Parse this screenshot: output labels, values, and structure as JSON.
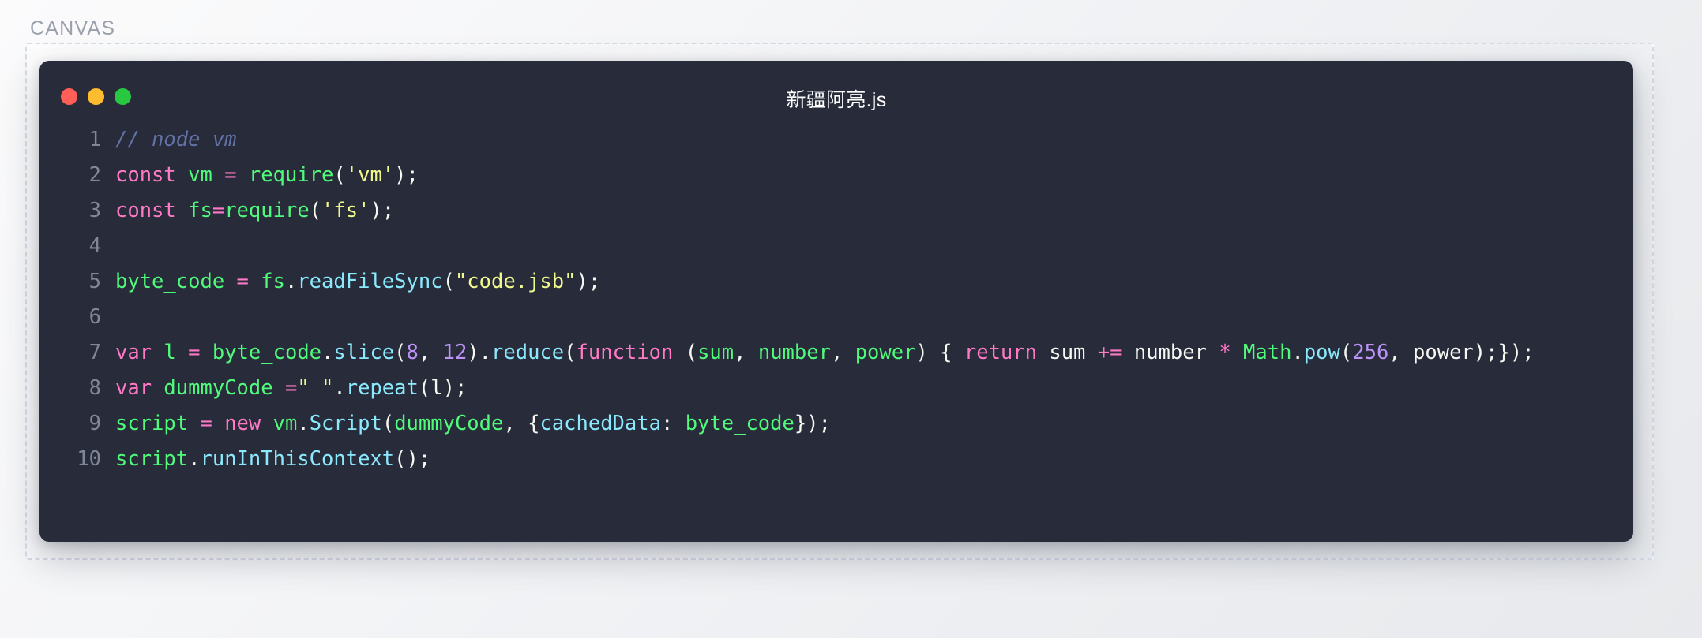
{
  "canvas": {
    "label": "CANVAS"
  },
  "window": {
    "title": "新疆阿亮.js",
    "traffic_lights": [
      {
        "name": "close",
        "color": "#ff5f57"
      },
      {
        "name": "minimize",
        "color": "#febc2e"
      },
      {
        "name": "maximize",
        "color": "#28c840"
      }
    ],
    "background_color": "#282c3a"
  },
  "editor": {
    "language": "javascript",
    "theme": "dracula",
    "line_numbers": [
      "1",
      "2",
      "3",
      "4",
      "5",
      "6",
      "7",
      "8",
      "9",
      "10"
    ],
    "lines": [
      {
        "number": "1",
        "text": "// node vm",
        "tokens": [
          {
            "t": "// node vm",
            "c": "t-comment"
          }
        ]
      },
      {
        "number": "2",
        "text": "const vm = require('vm');",
        "tokens": [
          {
            "t": "const",
            "c": "t-keyword"
          },
          {
            "t": " ",
            "c": "t-plain"
          },
          {
            "t": "vm",
            "c": "t-var"
          },
          {
            "t": " ",
            "c": "t-plain"
          },
          {
            "t": "=",
            "c": "t-op"
          },
          {
            "t": " ",
            "c": "t-plain"
          },
          {
            "t": "require",
            "c": "t-func"
          },
          {
            "t": "(",
            "c": "t-punct"
          },
          {
            "t": "'vm'",
            "c": "t-string"
          },
          {
            "t": ")",
            "c": "t-punct"
          },
          {
            "t": ";",
            "c": "t-punct"
          }
        ]
      },
      {
        "number": "3",
        "text": "const fs=require('fs');",
        "tokens": [
          {
            "t": "const",
            "c": "t-keyword"
          },
          {
            "t": " ",
            "c": "t-plain"
          },
          {
            "t": "fs",
            "c": "t-var"
          },
          {
            "t": "=",
            "c": "t-op"
          },
          {
            "t": "require",
            "c": "t-func"
          },
          {
            "t": "(",
            "c": "t-punct"
          },
          {
            "t": "'fs'",
            "c": "t-string"
          },
          {
            "t": ")",
            "c": "t-punct"
          },
          {
            "t": ";",
            "c": "t-punct"
          }
        ]
      },
      {
        "number": "4",
        "text": "",
        "tokens": []
      },
      {
        "number": "5",
        "text": "byte_code = fs.readFileSync(\"code.jsb\");",
        "tokens": [
          {
            "t": "byte_code",
            "c": "t-var"
          },
          {
            "t": " ",
            "c": "t-plain"
          },
          {
            "t": "=",
            "c": "t-op"
          },
          {
            "t": " ",
            "c": "t-plain"
          },
          {
            "t": "fs",
            "c": "t-var"
          },
          {
            "t": ".",
            "c": "t-punct"
          },
          {
            "t": "readFileSync",
            "c": "t-method"
          },
          {
            "t": "(",
            "c": "t-punct"
          },
          {
            "t": "\"code.jsb\"",
            "c": "t-string"
          },
          {
            "t": ")",
            "c": "t-punct"
          },
          {
            "t": ";",
            "c": "t-punct"
          }
        ]
      },
      {
        "number": "6",
        "text": "",
        "tokens": []
      },
      {
        "number": "7",
        "text": "var l = byte_code.slice(8, 12).reduce(function (sum, number, power) { return sum += number * Math.pow(256, power);});",
        "tokens": [
          {
            "t": "var",
            "c": "t-keyword"
          },
          {
            "t": " ",
            "c": "t-plain"
          },
          {
            "t": "l",
            "c": "t-var"
          },
          {
            "t": " ",
            "c": "t-plain"
          },
          {
            "t": "=",
            "c": "t-op"
          },
          {
            "t": " ",
            "c": "t-plain"
          },
          {
            "t": "byte_code",
            "c": "t-var"
          },
          {
            "t": ".",
            "c": "t-punct"
          },
          {
            "t": "slice",
            "c": "t-method"
          },
          {
            "t": "(",
            "c": "t-punct"
          },
          {
            "t": "8",
            "c": "t-number"
          },
          {
            "t": ", ",
            "c": "t-punct"
          },
          {
            "t": "12",
            "c": "t-number"
          },
          {
            "t": ")",
            "c": "t-punct"
          },
          {
            "t": ".",
            "c": "t-punct"
          },
          {
            "t": "reduce",
            "c": "t-method"
          },
          {
            "t": "(",
            "c": "t-punct"
          },
          {
            "t": "function",
            "c": "t-keyword"
          },
          {
            "t": " (",
            "c": "t-punct"
          },
          {
            "t": "sum",
            "c": "t-var"
          },
          {
            "t": ", ",
            "c": "t-punct"
          },
          {
            "t": "number",
            "c": "t-var"
          },
          {
            "t": ", ",
            "c": "t-punct"
          },
          {
            "t": "power",
            "c": "t-var"
          },
          {
            "t": ")",
            "c": "t-punct"
          },
          {
            "t": " { ",
            "c": "t-punct"
          },
          {
            "t": "return",
            "c": "t-keyword"
          },
          {
            "t": " sum ",
            "c": "t-plain"
          },
          {
            "t": "+=",
            "c": "t-op"
          },
          {
            "t": " number ",
            "c": "t-plain"
          },
          {
            "t": "*",
            "c": "t-op"
          },
          {
            "t": " ",
            "c": "t-plain"
          },
          {
            "t": "Math",
            "c": "t-var"
          },
          {
            "t": ".",
            "c": "t-punct"
          },
          {
            "t": "pow",
            "c": "t-method"
          },
          {
            "t": "(",
            "c": "t-punct"
          },
          {
            "t": "256",
            "c": "t-number"
          },
          {
            "t": ", ",
            "c": "t-punct"
          },
          {
            "t": "power",
            "c": "t-plain"
          },
          {
            "t": ");});",
            "c": "t-punct"
          }
        ]
      },
      {
        "number": "8",
        "text": "var dummyCode =\" \".repeat(l);",
        "tokens": [
          {
            "t": "var",
            "c": "t-keyword"
          },
          {
            "t": " ",
            "c": "t-plain"
          },
          {
            "t": "dummyCode",
            "c": "t-var"
          },
          {
            "t": " ",
            "c": "t-plain"
          },
          {
            "t": "=",
            "c": "t-op"
          },
          {
            "t": "\" \"",
            "c": "t-string"
          },
          {
            "t": ".",
            "c": "t-punct"
          },
          {
            "t": "repeat",
            "c": "t-method"
          },
          {
            "t": "(",
            "c": "t-punct"
          },
          {
            "t": "l",
            "c": "t-plain"
          },
          {
            "t": ")",
            "c": "t-punct"
          },
          {
            "t": ";",
            "c": "t-punct"
          }
        ]
      },
      {
        "number": "9",
        "text": "script = new vm.Script(dummyCode, {cachedData: byte_code});",
        "tokens": [
          {
            "t": "script",
            "c": "t-var"
          },
          {
            "t": " ",
            "c": "t-plain"
          },
          {
            "t": "=",
            "c": "t-op"
          },
          {
            "t": " ",
            "c": "t-plain"
          },
          {
            "t": "new",
            "c": "t-keyword"
          },
          {
            "t": " ",
            "c": "t-plain"
          },
          {
            "t": "vm",
            "c": "t-var"
          },
          {
            "t": ".",
            "c": "t-punct"
          },
          {
            "t": "Script",
            "c": "t-method"
          },
          {
            "t": "(",
            "c": "t-punct"
          },
          {
            "t": "dummyCode",
            "c": "t-var"
          },
          {
            "t": ", ",
            "c": "t-punct"
          },
          {
            "t": "{",
            "c": "t-punct"
          },
          {
            "t": "cachedData",
            "c": "t-prop"
          },
          {
            "t": ": ",
            "c": "t-punct"
          },
          {
            "t": "byte_code",
            "c": "t-var"
          },
          {
            "t": "});",
            "c": "t-punct"
          }
        ]
      },
      {
        "number": "10",
        "text": "script.runInThisContext();",
        "tokens": [
          {
            "t": "script",
            "c": "t-var"
          },
          {
            "t": ".",
            "c": "t-punct"
          },
          {
            "t": "runInThisContext",
            "c": "t-method"
          },
          {
            "t": "(",
            "c": "t-punct"
          },
          {
            "t": ")",
            "c": "t-punct"
          },
          {
            "t": ";",
            "c": "t-punct"
          }
        ]
      }
    ]
  },
  "palette": {
    "comment": "#6272a4",
    "keyword": "#ff79c6",
    "function": "#50fa7b",
    "method": "#8be9fd",
    "string": "#f1fa8c",
    "number": "#bd93f9",
    "plain": "#f8f8f2",
    "line_number": "#7f8798",
    "editor_bg": "#282c3a",
    "canvas_border": "#d6dbe8",
    "canvas_label": "#9ba1ac"
  }
}
